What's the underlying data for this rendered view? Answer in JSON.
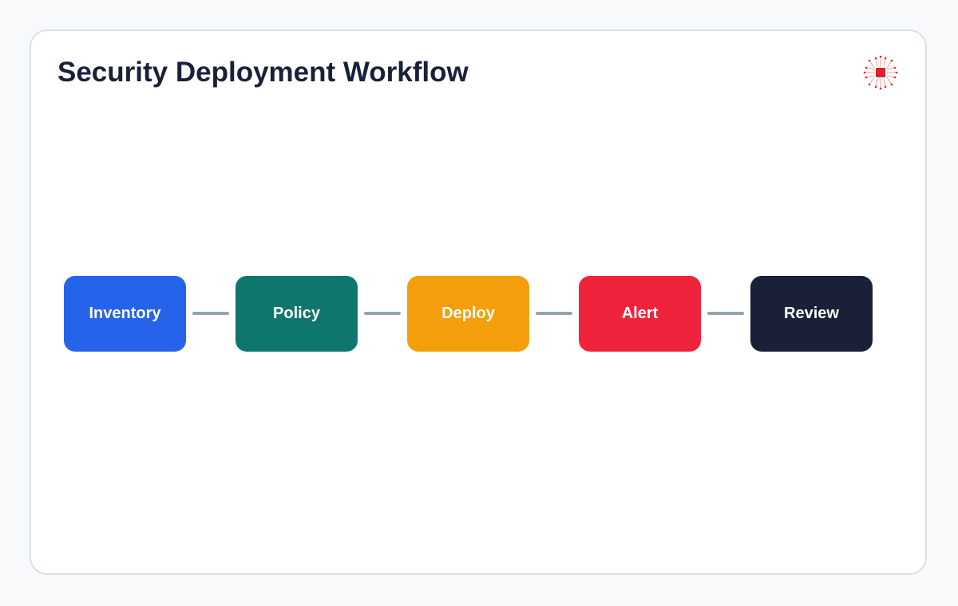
{
  "title": "Security Deployment Workflow",
  "logo": {
    "icon": "circuit-chip-icon",
    "colors": {
      "primary": "#e5202e",
      "secondary": "#f19a9a"
    }
  },
  "steps": [
    {
      "label": "Inventory",
      "color": "#2563eb"
    },
    {
      "label": "Policy",
      "color": "#0f766e"
    },
    {
      "label": "Deploy",
      "color": "#f59e0b"
    },
    {
      "label": "Alert",
      "color": "#ef233c"
    },
    {
      "label": "Review",
      "color": "#192037"
    }
  ],
  "connector_color": "#94a3b0"
}
